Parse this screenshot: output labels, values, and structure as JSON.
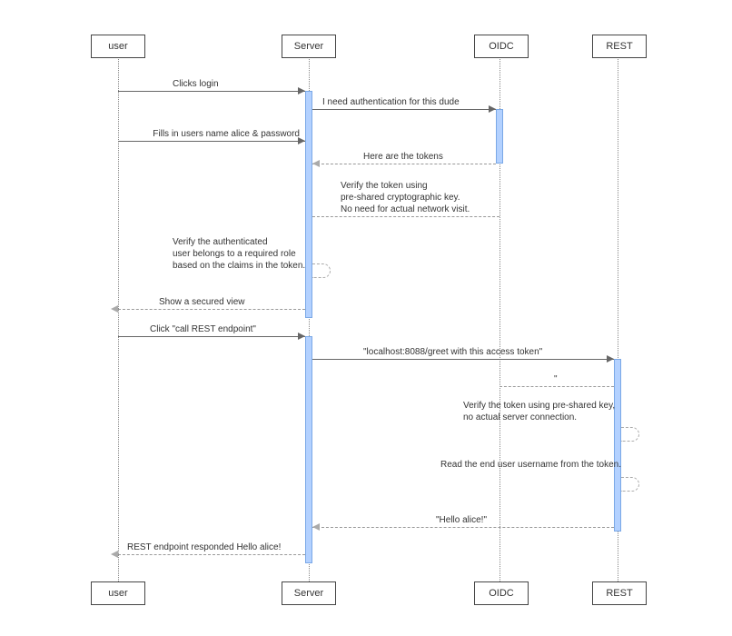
{
  "participants": {
    "user": "user",
    "server": "Server",
    "oidc": "OIDC",
    "rest": "REST"
  },
  "messages": {
    "m1": "Clicks login",
    "m2": "I need authentication for this dude",
    "m3": "Fills in users name alice & password",
    "m4": "Here are the tokens",
    "m5_l1": "Verify the token using",
    "m5_l2": "pre-shared cryptographic key.",
    "m5_l3": "No need for actual network visit.",
    "m6_l1": "Verify the authenticated",
    "m6_l2": "user belongs to a required role",
    "m6_l3": "based on the claims in the token.",
    "m7": "Show a secured view",
    "m8": "Click \"call REST endpoint\"",
    "m9": "\"localhost:8088/greet with this access token\"",
    "m10": "\"",
    "m11_l1": "Verify the token using pre-shared key,",
    "m11_l2": "no actual server connection.",
    "m12": "Read the end user username from the token.",
    "m13": "\"Hello alice!\"",
    "m14": "REST endpoint responded Hello alice!"
  }
}
